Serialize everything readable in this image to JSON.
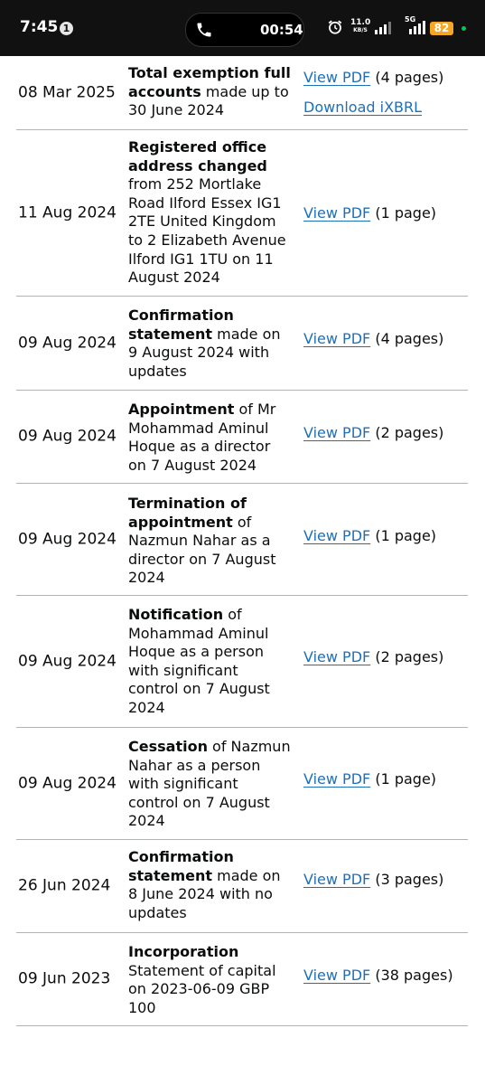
{
  "status_bar": {
    "time": "7:45",
    "info_badge": "1",
    "call_timer": "00:54",
    "net_speed_value": "11.0",
    "net_speed_unit": "KB/S",
    "network_type": "5G",
    "battery": "82"
  },
  "filings": [
    {
      "date": "08 Mar 2025",
      "desc_bold": "Total exemption full accounts",
      "desc_rest": " made up to 30 June 2024",
      "link_label": "View PDF",
      "pages": "(4 pages)",
      "secondary_link": "Download iXBRL"
    },
    {
      "date": "11 Aug 2024",
      "desc_bold": "Registered office address changed",
      "desc_rest": " from 252 Mortlake Road Ilford Essex IG1 2TE United Kingdom to 2 Elizabeth Avenue Ilford IG1 1TU on 11 August 2024",
      "link_label": "View PDF",
      "pages": "(1 page)"
    },
    {
      "date": "09 Aug 2024",
      "desc_bold": "Confirmation statement",
      "desc_rest": " made on 9 August 2024 with updates",
      "link_label": "View PDF",
      "pages": "(4 pages)"
    },
    {
      "date": "09 Aug 2024",
      "desc_bold": "Appointment",
      "desc_rest": " of Mr Mohammad Aminul Hoque as a director on 7 August 2024",
      "link_label": "View PDF",
      "pages": "(2 pages)"
    },
    {
      "date": "09 Aug 2024",
      "desc_bold": "Termination of appointment",
      "desc_rest": " of Nazmun Nahar as a director on 7 August 2024",
      "link_label": "View PDF",
      "pages": "(1 page)"
    },
    {
      "date": "09 Aug 2024",
      "desc_bold": "Notification",
      "desc_rest": " of Mohammad Aminul Hoque as a person with significant control on 7 August 2024",
      "link_label": "View PDF",
      "pages": "(2 pages)"
    },
    {
      "date": "09 Aug 2024",
      "desc_bold": "Cessation",
      "desc_rest": " of Nazmun Nahar as a person with significant control on 7 August 2024",
      "link_label": "View PDF",
      "pages": "(1 page)"
    },
    {
      "date": "26 Jun 2024",
      "desc_bold": "Confirmation statement",
      "desc_rest": " made on 8 June 2024 with no updates",
      "link_label": "View PDF",
      "pages": "(3 pages)"
    },
    {
      "date": "09 Jun 2023",
      "desc_bold": "Incorporation",
      "desc_rest": " Statement of capital on 2023-06-09 GBP 100",
      "link_label": "View PDF",
      "pages": "(38 pages)"
    }
  ]
}
